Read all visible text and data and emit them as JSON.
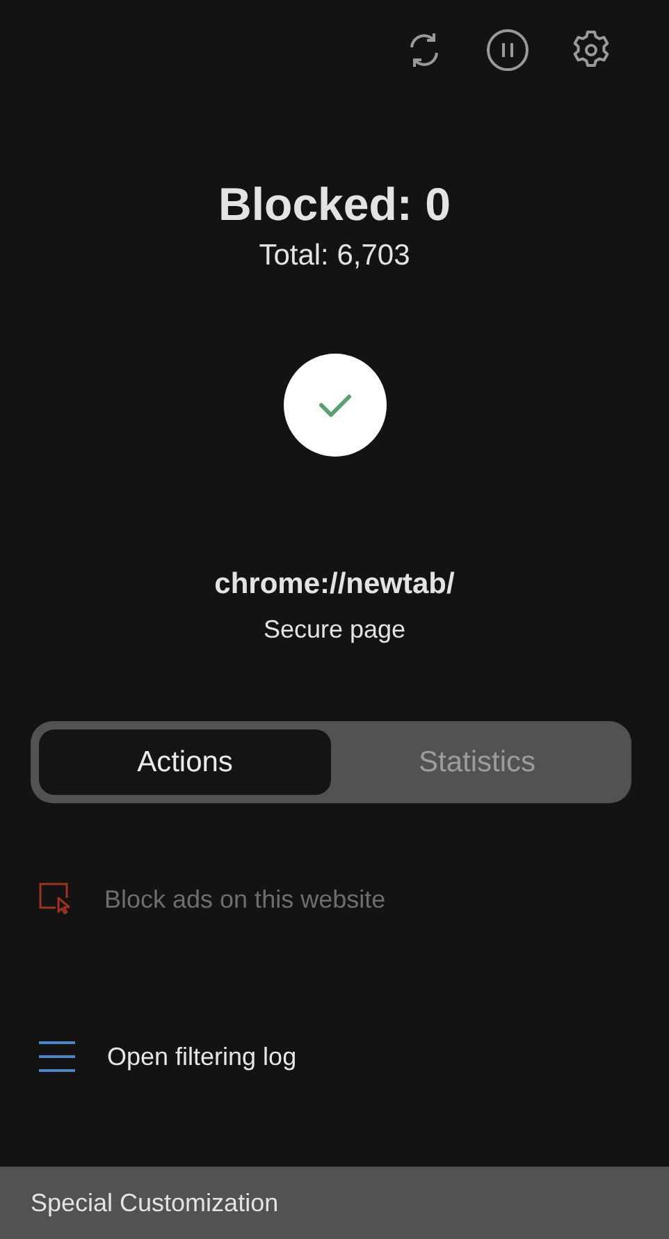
{
  "toolbar": [
    {
      "kind": "refresh"
    },
    {
      "kind": "pause"
    },
    {
      "kind": "settings"
    }
  ],
  "stats": {
    "blocked": "Blocked: 0",
    "total": "Total: 6,703"
  },
  "status": {
    "secure": true
  },
  "site": {
    "url": "chrome://newtab/",
    "note": "Secure page"
  },
  "tabs": [
    {
      "label": "Actions",
      "selected": true
    },
    {
      "label": "Statistics",
      "selected": false
    }
  ],
  "actions": [
    {
      "kind": "block",
      "label": "Block ads on this website",
      "disabled": true
    },
    {
      "kind": "log",
      "label": "Open filtering log",
      "disabled": false
    }
  ],
  "footer": {
    "label": "Special Customization"
  }
}
